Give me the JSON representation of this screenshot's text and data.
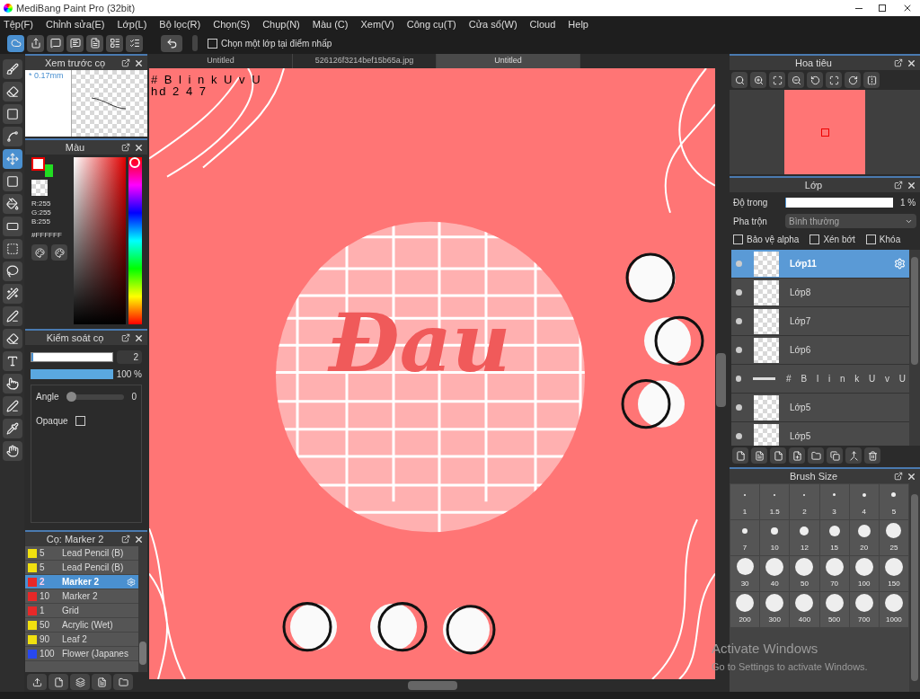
{
  "window": {
    "title": "MediBang Paint Pro (32bit)"
  },
  "menu": [
    "Tệp(F)",
    "Chỉnh sửa(E)",
    "Lớp(L)",
    "Bộ lọc(R)",
    "Chọn(S)",
    "Chụp(N)",
    "Màu (C)",
    "Xem(V)",
    "Công cụ(T)",
    "Cửa sổ(W)",
    "Cloud",
    "Help"
  ],
  "toolbar": {
    "checkbox": {
      "label": "Chọn một lớp tại điểm nhấp",
      "checked": false
    }
  },
  "doc_tabs": [
    {
      "label": "Untitled",
      "selected": false
    },
    {
      "label": "526126f3214bef15b65a.jpg",
      "selected": false
    },
    {
      "label": "Untitled",
      "selected": true
    }
  ],
  "brush_preview": {
    "title": "Xem trước cọ",
    "size": "* 0.17mm"
  },
  "color_panel": {
    "title": "Màu",
    "r": "R:255",
    "g": "G:255",
    "b": "B:255",
    "hex": "#FFFFFF"
  },
  "brush_control": {
    "title": "Kiểm soát cọ",
    "size": "2",
    "size_slider": {
      "level": 0.02
    },
    "opacity": "100 %",
    "opacity_slider": {
      "level": 1
    },
    "angle_label": "Angle",
    "angle_value": "0",
    "angle_slider": {
      "level": 0
    },
    "opaque_label": "Opaque",
    "opaque_checked": false
  },
  "brush_list": {
    "title": "Cọ: Marker 2",
    "items": [
      {
        "size": "5",
        "name": "Lead Pencil (B)",
        "color": "#f0e010",
        "selected": false
      },
      {
        "size": "5",
        "name": "Lead Pencil (B)",
        "color": "#f0e010",
        "selected": false
      },
      {
        "size": "2",
        "name": "Marker 2",
        "color": "#e82828",
        "selected": true
      },
      {
        "size": "10",
        "name": "Marker 2",
        "color": "#e82828",
        "selected": false
      },
      {
        "size": "1",
        "name": "Grid",
        "color": "#e82828",
        "selected": false
      },
      {
        "size": "50",
        "name": "Acrylic (Wet)",
        "color": "#f0e010",
        "selected": false
      },
      {
        "size": "90",
        "name": "Leaf 2",
        "color": "#f0e010",
        "selected": false
      },
      {
        "size": "100",
        "name": "Flower (Japanes",
        "color": "#2848f0",
        "selected": false
      }
    ]
  },
  "canvas": {
    "caption_line_1": "# B l i n k U v U",
    "caption_line_2": "hd 2 4 7",
    "title": "Đau"
  },
  "navigator": {
    "title": "Hoa tiêu"
  },
  "layers": {
    "title": "Lớp",
    "opacity_label": "Độ trong",
    "opacity_value": "1 %",
    "opacity_slider": {
      "level": 0.01
    },
    "blend_label": "Pha trộn",
    "blend_value": "Bình thường",
    "options": [
      {
        "label": "Bảo vệ alpha",
        "checked": false
      },
      {
        "label": "Xén bớt",
        "checked": false
      },
      {
        "label": "Khóa",
        "checked": false
      }
    ],
    "items": [
      {
        "name": "Lớp11",
        "kind": "image",
        "selected": true
      },
      {
        "name": "Lớp8",
        "kind": "image",
        "selected": false
      },
      {
        "name": "Lớp7",
        "kind": "image",
        "selected": false
      },
      {
        "name": "Lớp6",
        "kind": "image",
        "selected": false
      },
      {
        "name": "# B l i n k U v U",
        "kind": "text",
        "selected": false
      },
      {
        "name": "Lớp5",
        "kind": "image",
        "selected": false
      },
      {
        "name": "Lớp5",
        "kind": "image",
        "selected": false
      }
    ]
  },
  "brush_size": {
    "title": "Brush Size",
    "sizes": [
      "1",
      "1.5",
      "2",
      "3",
      "4",
      "5",
      "7",
      "10",
      "12",
      "15",
      "20",
      "25",
      "30",
      "40",
      "50",
      "70",
      "100",
      "150",
      "200",
      "300",
      "400",
      "500",
      "700",
      "1000"
    ]
  },
  "activation": {
    "title": "Activate Windows",
    "subtitle": "Go to Settings to activate Windows."
  }
}
